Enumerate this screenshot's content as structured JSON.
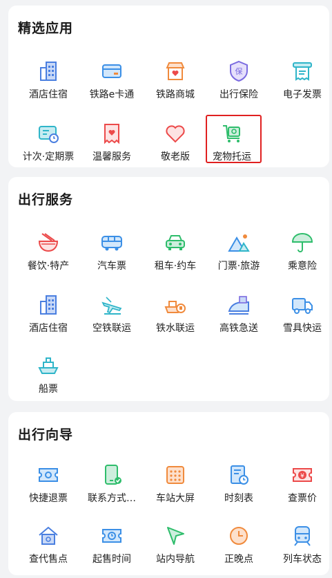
{
  "sections": [
    {
      "title": "精选应用",
      "items": [
        {
          "label": "酒店住宿",
          "icon": "hotel-icon"
        },
        {
          "label": "铁路e卡通",
          "icon": "card-icon"
        },
        {
          "label": "铁路商城",
          "icon": "shop-icon"
        },
        {
          "label": "出行保险",
          "icon": "insurance-icon",
          "badge": "保"
        },
        {
          "label": "电子发票",
          "icon": "invoice-icon"
        },
        {
          "label": "计次·定期票",
          "icon": "periodic-ticket-icon"
        },
        {
          "label": "温馨服务",
          "icon": "care-service-icon"
        },
        {
          "label": "敬老版",
          "icon": "elder-heart-icon"
        },
        {
          "label": "宠物托运",
          "icon": "pet-carrier-icon",
          "highlighted": true
        }
      ]
    },
    {
      "title": "出行服务",
      "items": [
        {
          "label": "餐饮·特产",
          "icon": "noodle-bowl-icon"
        },
        {
          "label": "汽车票",
          "icon": "bus-icon"
        },
        {
          "label": "租车·约车",
          "icon": "car-icon"
        },
        {
          "label": "门票·旅游",
          "icon": "mountain-icon"
        },
        {
          "label": "乘意险",
          "icon": "umbrella-icon"
        },
        {
          "label": "酒店住宿",
          "icon": "hotel-icon"
        },
        {
          "label": "空铁联运",
          "icon": "plane-icon"
        },
        {
          "label": "铁水联运",
          "icon": "ship-rail-icon"
        },
        {
          "label": "高铁急送",
          "icon": "express-train-icon"
        },
        {
          "label": "雪具快运",
          "icon": "truck-icon"
        },
        {
          "label": "船票",
          "icon": "ship-icon"
        }
      ]
    },
    {
      "title": "出行向导",
      "items": [
        {
          "label": "快捷退票",
          "icon": "refund-ticket-icon"
        },
        {
          "label": "联系方式…",
          "icon": "phone-check-icon"
        },
        {
          "label": "车站大屏",
          "icon": "station-board-icon"
        },
        {
          "label": "时刻表",
          "icon": "timetable-icon"
        },
        {
          "label": "查票价",
          "icon": "price-ticket-icon",
          "badge": "¥"
        },
        {
          "label": "查代售点",
          "icon": "agency-home-icon"
        },
        {
          "label": "起售时间",
          "icon": "sale-time-icon"
        },
        {
          "label": "站内导航",
          "icon": "navigation-arrow-icon"
        },
        {
          "label": "正晚点",
          "icon": "clock-icon"
        },
        {
          "label": "列车状态",
          "icon": "train-status-icon"
        }
      ]
    }
  ],
  "colors": {
    "blue": "#4a7fe0",
    "cyan": "#2fb5c9",
    "orange": "#f08a3c",
    "red": "#ec4a4a",
    "green": "#2ebd6b",
    "highlight": "#e02020"
  }
}
